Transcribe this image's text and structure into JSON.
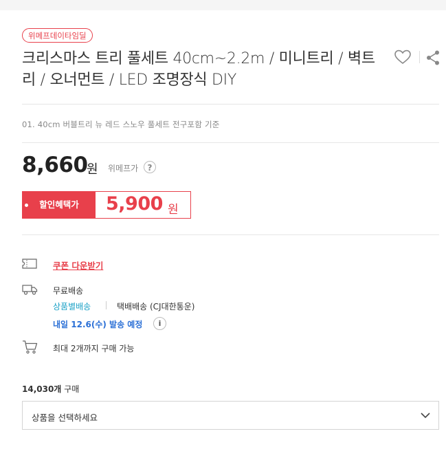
{
  "badge": "위메프데이타임딜",
  "title": "크리스마스 트리 풀세트 40cm~2.2m / 미니트리 / 벽트리 / 오너먼트 / LED 조명장식 DIY",
  "option_note": "01. 40cm 버블트리 뉴 레드 스노우 풀세트 전구포함 기준",
  "price": {
    "value": "8,660",
    "unit": "원",
    "label": "위메프가",
    "help": "?"
  },
  "discount": {
    "label": "할인혜택가",
    "value": "5,900",
    "unit": "원"
  },
  "coupon": {
    "label": "쿠폰 다운받기"
  },
  "shipping": {
    "fee": "무료배송",
    "type": "상품별배송",
    "carrier": "택배배송 (CJ대한통운)",
    "eta": "내일 12.6(수) 발송 예정",
    "info": "i"
  },
  "limit": "최대 2개까지 구매 가능",
  "sold": {
    "count": "14,030개",
    "label": "구매"
  },
  "select": {
    "placeholder": "상품을 선택하세요"
  },
  "icons": {
    "wish": "heart-icon",
    "share": "share-icon",
    "coupon": "ticket-icon",
    "shipping": "truck-icon",
    "cart": "cart-icon",
    "dropdown": "chevron-down-icon"
  },
  "colors": {
    "accent": "#e8404b",
    "link_blue": "#1aa1c6",
    "eta_blue": "#2a6fd6"
  }
}
